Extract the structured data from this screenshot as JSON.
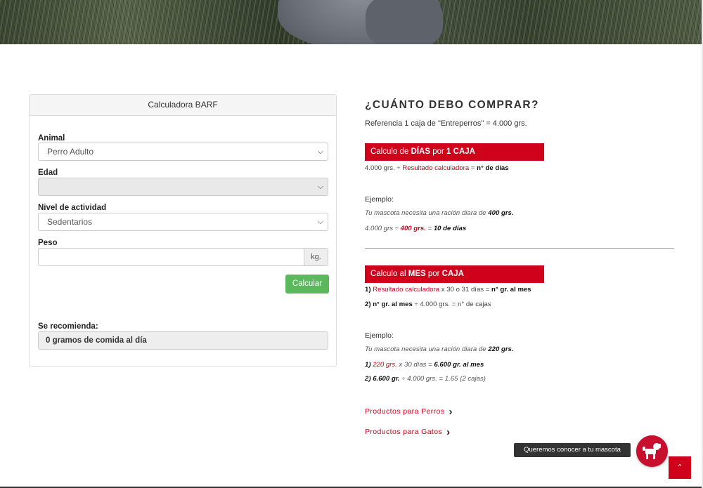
{
  "calculator": {
    "title": "Calculadora BARF",
    "animal_label": "Animal",
    "animal_value": "Perro Adulto",
    "edad_label": "Edad",
    "edad_value": "",
    "actividad_label": "Nivel de actividad",
    "actividad_value": "Sedentarios",
    "peso_label": "Peso",
    "peso_value": "",
    "peso_unit": "kg.",
    "calcular_button": "Calcular",
    "recomienda_label": "Se recomienda:",
    "recomienda_value": "0 gramos de comida al día"
  },
  "info": {
    "title": "¿CUÁNTO DEBO COMPRAR?",
    "reference": "Referencia 1 caja de \"Entreperros\" = 4.000 grs.",
    "dias": {
      "banner_pre": "Calculo de ",
      "banner_b1": "DÍAS",
      "banner_mid": " por ",
      "banner_b2": "1 CAJA",
      "formula_a": "4.000 grs. ÷ ",
      "formula_red": "Resultado calculadora",
      "formula_b": " = ",
      "formula_bold": "n° de días",
      "ejemplo_label": "Ejemplo:",
      "ej1_text": "Tu mascota necesita una ración diara de ",
      "ej1_bold": "400 grs.",
      "ej2_a": "4.000 grs ÷ ",
      "ej2_red": "400 grs.",
      "ej2_b": " = ",
      "ej2_bold": "10 de días"
    },
    "mes": {
      "banner_pre": "Calculo al ",
      "banner_b1": "MES",
      "banner_mid": " por ",
      "banner_b2": "CAJA",
      "f1_num": "1) ",
      "f1_red": "Resultado calculadora",
      "f1_mid": " x 30 o 31 días = ",
      "f1_bold": "n° gr. al mes",
      "f2_bold": "2) n° gr. al mes",
      "f2_rest": " ÷ 4.000 grs. = n° de cajas",
      "ejemplo_label": "Ejemplo:",
      "ej1_text": "Tu mascota necesita una ración diara de ",
      "ej1_bold": "220 grs.",
      "ej2_num": "1) ",
      "ej2_red": "220 grs.",
      "ej2_mid": " x 30 días = ",
      "ej2_bold": "6.600 gr. al mes",
      "ej3_bold": "2) 6.600 gr.",
      "ej3_rest": " ÷ 4.000 grs. = 1.65 (2 cajas)"
    },
    "link_perros": "Productos para Perros",
    "link_gatos": "Productos para Gatos"
  },
  "widget": {
    "tooltip": "Queremos conocer a tu mascota",
    "icons": {
      "dog": "dog-icon",
      "up": "chevron-up-icon",
      "chevron": "chevron-right-icon"
    }
  },
  "colors": {
    "accent": "#d0021b",
    "button_green": "#5cb85c"
  }
}
